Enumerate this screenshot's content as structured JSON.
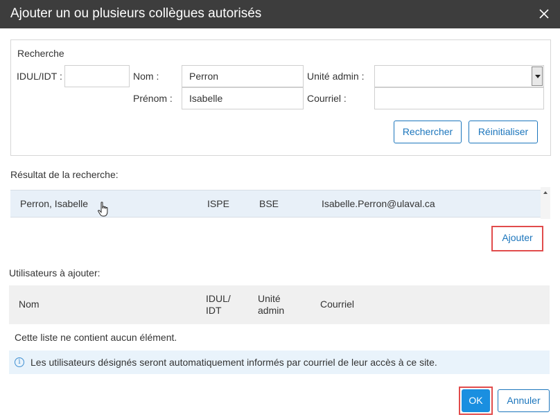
{
  "dialog": {
    "title": "Ajouter un ou plusieurs collègues autorisés",
    "close_icon": "close-icon"
  },
  "search": {
    "legend": "Recherche",
    "idul_label": "IDUL/IDT :",
    "idul_value": "",
    "nom_label": "Nom :",
    "nom_value": "Perron",
    "prenom_label": "Prénom :",
    "prenom_value": "Isabelle",
    "unite_label": "Unité admin :",
    "unite_value": "",
    "courriel_label": "Courriel :",
    "courriel_value": "",
    "search_button": "Rechercher",
    "reset_button": "Réinitialiser"
  },
  "results": {
    "title": "Résultat de la recherche:",
    "rows": [
      {
        "name": "Perron, Isabelle",
        "idul": "ISPE",
        "unite": "BSE",
        "email": "Isabelle.Perron@ulaval.ca"
      }
    ],
    "add_button": "Ajouter"
  },
  "users_to_add": {
    "title": "Utilisateurs à ajouter:",
    "columns": {
      "nom": "Nom",
      "idul_line1": "IDUL/",
      "idul_line2": "IDT",
      "unite_line1": "Unité",
      "unite_line2": "admin",
      "courriel": "Courriel"
    },
    "empty_text": "Cette liste ne contient aucun élément."
  },
  "info": {
    "icon": "info-icon",
    "text": "Les utilisateurs désignés seront automatiquement informés par courriel de leur accès à ce site."
  },
  "footer": {
    "ok_button": "OK",
    "cancel_button": "Annuler"
  },
  "colors": {
    "title_bar": "#3d3d3d",
    "accent": "#1b75bc",
    "primary_button": "#1a8fe0",
    "highlight": "#e14b4b",
    "selected_row": "#e8f0f8"
  }
}
